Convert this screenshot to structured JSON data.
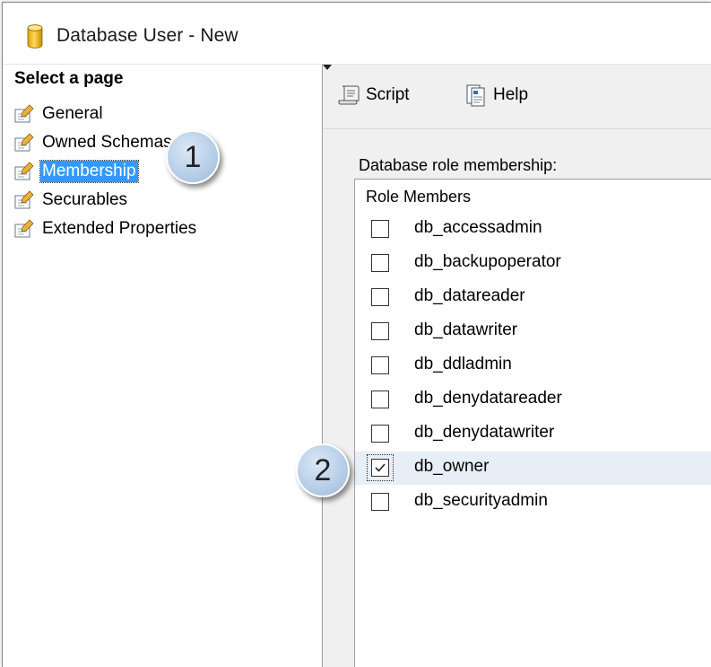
{
  "window": {
    "title": "Database User - New"
  },
  "left_pane": {
    "header": "Select a page",
    "pages": [
      {
        "label": "General",
        "selected": false
      },
      {
        "label": "Owned Schemas",
        "selected": false
      },
      {
        "label": "Membership",
        "selected": true
      },
      {
        "label": "Securables",
        "selected": false
      },
      {
        "label": "Extended Properties",
        "selected": false
      }
    ]
  },
  "toolbar": {
    "script_label": "Script",
    "help_label": "Help"
  },
  "main": {
    "role_membership_label": "Database role membership:",
    "column_header": "Role Members",
    "roles": [
      {
        "name": "db_accessadmin",
        "checked": false
      },
      {
        "name": "db_backupoperator",
        "checked": false
      },
      {
        "name": "db_datareader",
        "checked": false
      },
      {
        "name": "db_datawriter",
        "checked": false
      },
      {
        "name": "db_ddladmin",
        "checked": false
      },
      {
        "name": "db_denydatareader",
        "checked": false
      },
      {
        "name": "db_denydatawriter",
        "checked": false
      },
      {
        "name": "db_owner",
        "checked": true
      },
      {
        "name": "db_securityadmin",
        "checked": false
      }
    ]
  },
  "callouts": {
    "one": "1",
    "two": "2"
  },
  "colors": {
    "selection": "#3399ff",
    "callout": "#b8cfe8",
    "row_highlight": "#e8eef6"
  },
  "icons": [
    "database-icon",
    "page-properties-icon",
    "script-icon",
    "dropdown-arrow-icon",
    "help-icon",
    "checkmark-icon"
  ]
}
